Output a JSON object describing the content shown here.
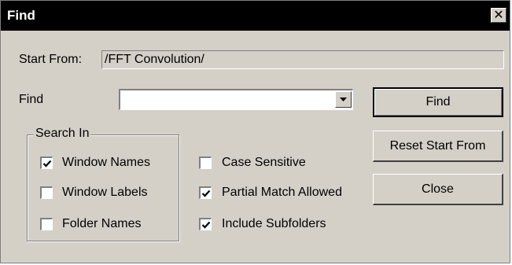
{
  "window": {
    "title": "Find",
    "close_glyph": "✕"
  },
  "start_from": {
    "label": "Start From:",
    "value": "/FFT Convolution/"
  },
  "find": {
    "label": "Find",
    "value": ""
  },
  "buttons": {
    "find": "Find",
    "reset": "Reset Start From",
    "close": "Close"
  },
  "search_in": {
    "label": "Search In",
    "options": [
      {
        "label": "Window Names",
        "checked": true
      },
      {
        "label": "Window Labels",
        "checked": false
      },
      {
        "label": "Folder Names",
        "checked": false
      }
    ]
  },
  "options": [
    {
      "label": "Case Sensitive",
      "checked": false
    },
    {
      "label": "Partial Match Allowed",
      "checked": true
    },
    {
      "label": "Include Subfolders",
      "checked": true
    }
  ],
  "colors": {
    "dialog_bg": "#d4d0c8",
    "titlebar_bg": "#000000",
    "titlebar_text": "#ffffff"
  }
}
